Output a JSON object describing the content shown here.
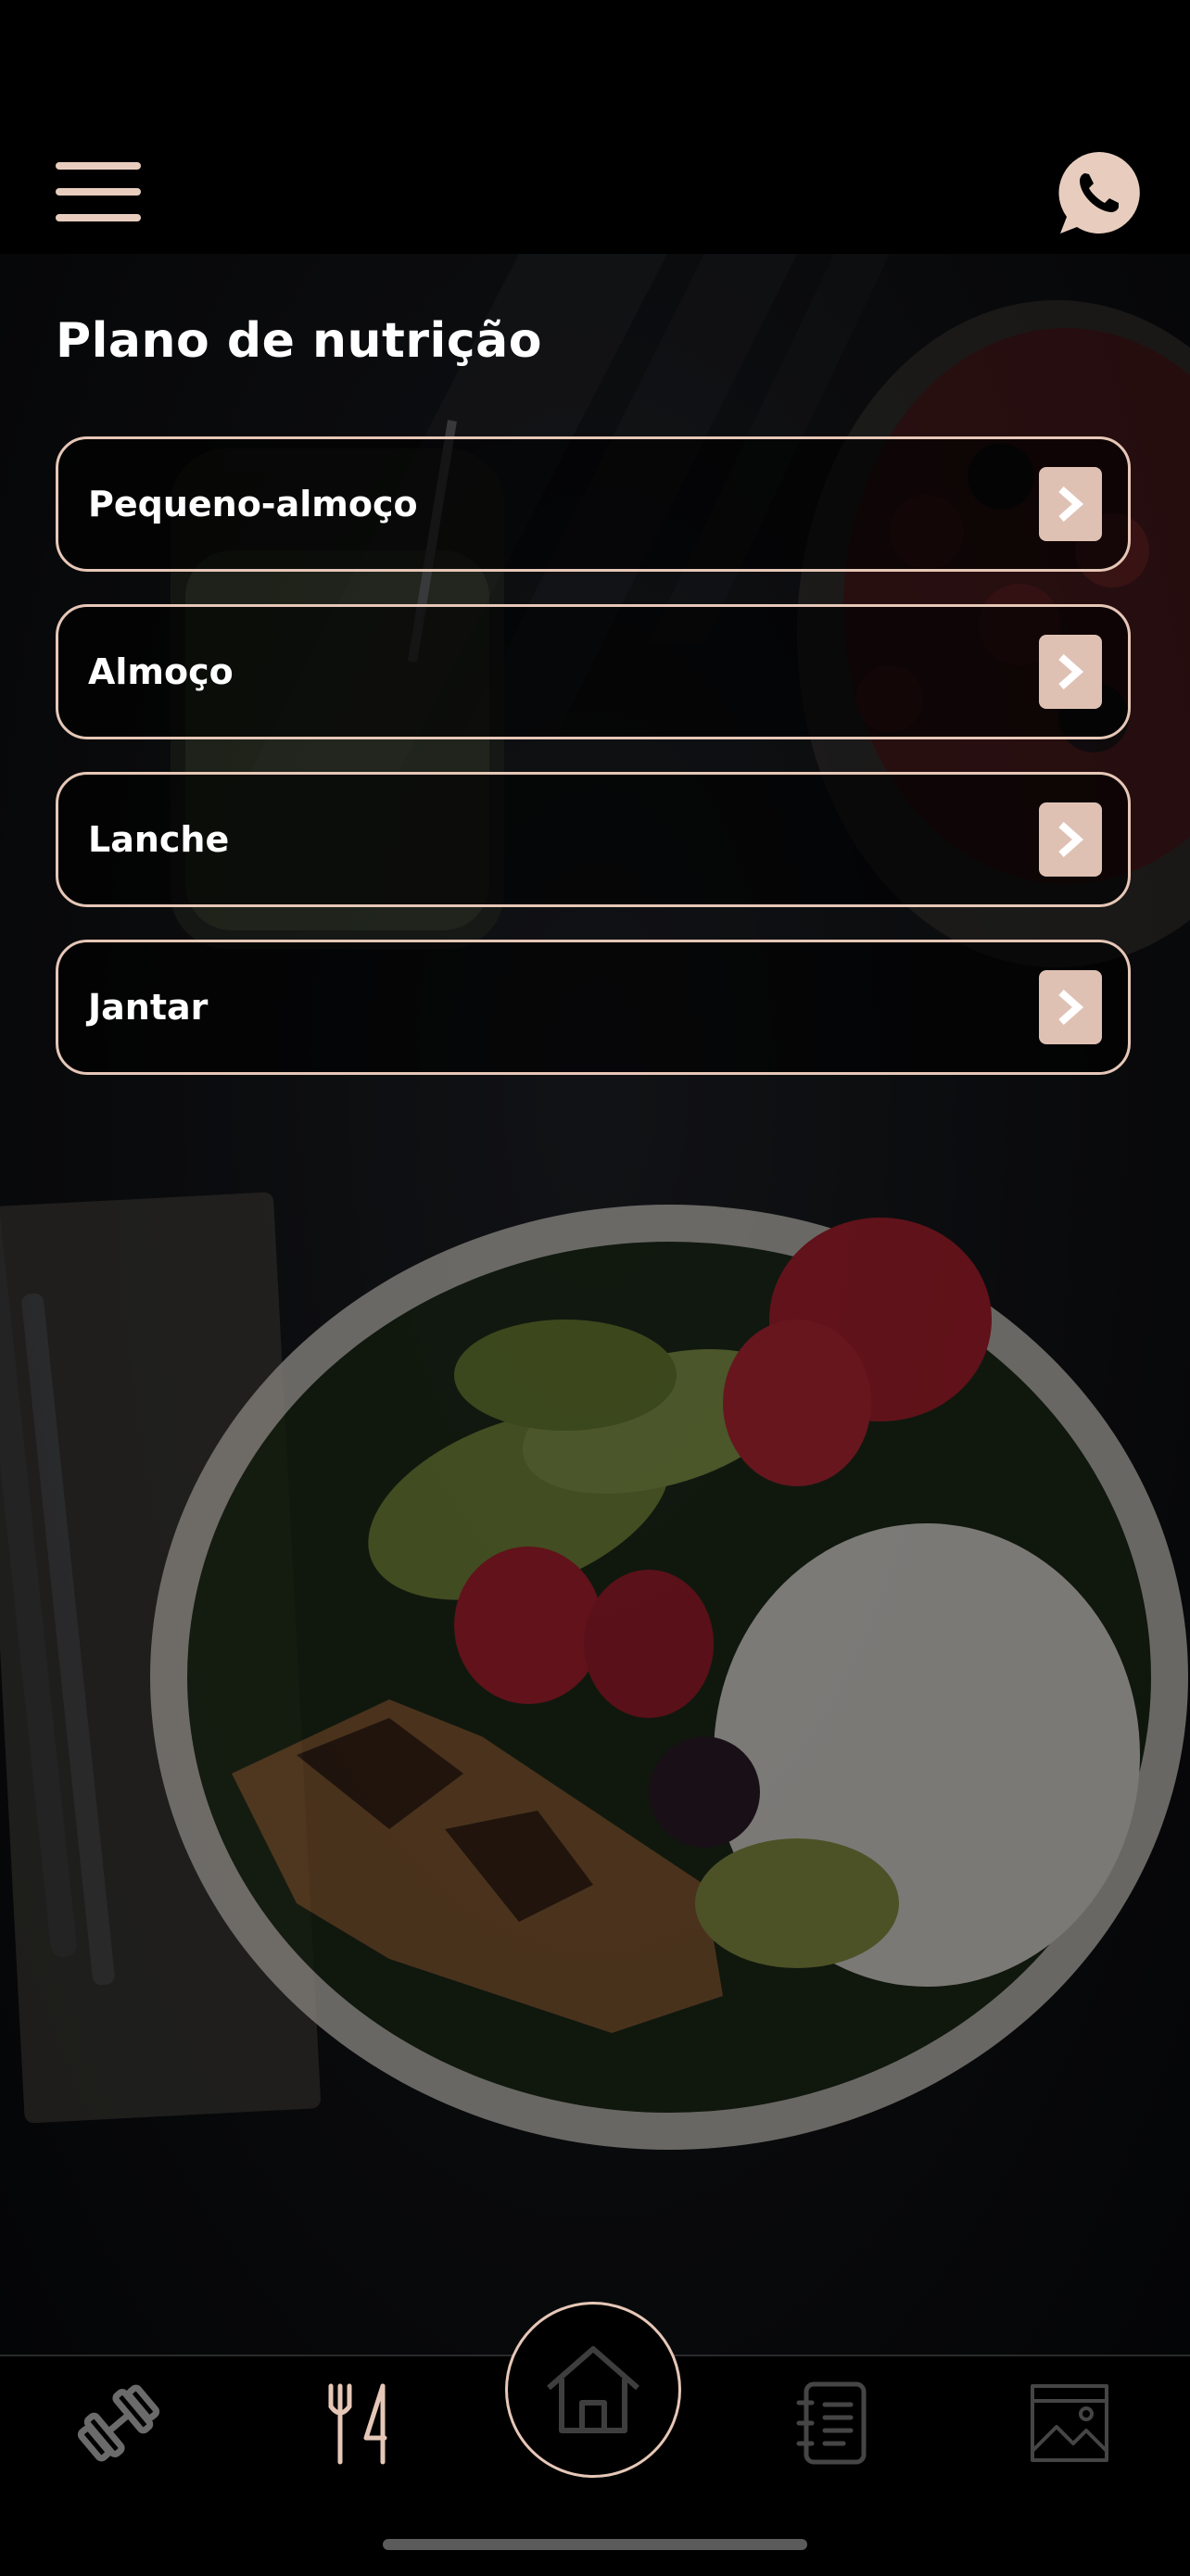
{
  "header": {
    "menu_icon": "hamburger-menu-icon",
    "contact_icon": "whatsapp-phone-icon"
  },
  "page": {
    "title": "Plano de nutrição"
  },
  "meals": [
    {
      "label": "Pequeno-almoço",
      "icon": "chevron-right-icon"
    },
    {
      "label": "Almoço",
      "icon": "chevron-right-icon"
    },
    {
      "label": "Lanche",
      "icon": "chevron-right-icon"
    },
    {
      "label": "Jantar",
      "icon": "chevron-right-icon"
    }
  ],
  "tab_bar": {
    "tabs": [
      {
        "icon": "dumbbell-icon",
        "active": false
      },
      {
        "icon": "fork-knife-icon",
        "active": true
      },
      {
        "icon": "home-icon",
        "active": false
      },
      {
        "icon": "notebook-icon",
        "active": false
      },
      {
        "icon": "gallery-image-icon",
        "active": false
      }
    ]
  },
  "colors": {
    "accent": "#e6c7b7",
    "background": "#000000",
    "inactive_icon": "#6b6b6b"
  }
}
